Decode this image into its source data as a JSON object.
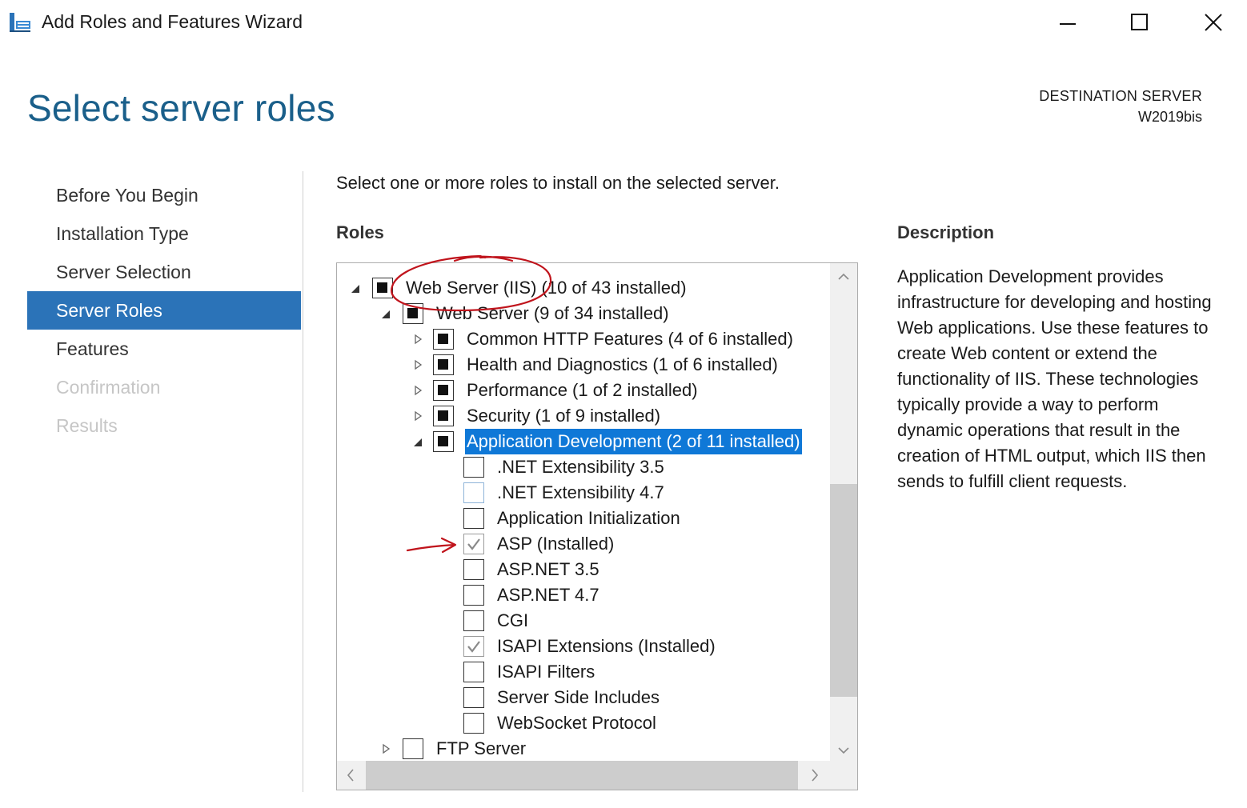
{
  "window": {
    "title": "Add Roles and Features Wizard",
    "icon": "server-manager-icon",
    "controls": [
      "minimize-icon",
      "maximize-icon",
      "close-icon"
    ]
  },
  "header": {
    "page_title": "Select server roles",
    "destination_label": "DESTINATION SERVER",
    "destination_name": "W2019bis"
  },
  "nav": {
    "items": [
      {
        "label": "Before You Begin",
        "state": "enabled"
      },
      {
        "label": "Installation Type",
        "state": "enabled"
      },
      {
        "label": "Server Selection",
        "state": "enabled"
      },
      {
        "label": "Server Roles",
        "state": "active"
      },
      {
        "label": "Features",
        "state": "enabled"
      },
      {
        "label": "Confirmation",
        "state": "disabled"
      },
      {
        "label": "Results",
        "state": "disabled"
      }
    ]
  },
  "main": {
    "instructions": "Select one or more roles to install on the selected server.",
    "roles_heading": "Roles",
    "description_heading": "Description",
    "description_text": "Application Development provides infrastructure for developing and hosting Web applications. Use these features to create Web content or extend the functionality of IIS. These technologies typically provide a way to perform dynamic operations that result in the creation of HTML output, which IIS then sends to fulfill client requests."
  },
  "roles_tree": [
    {
      "label": "Web Server (IIS) (10 of 43 installed)",
      "level": 0,
      "expander": "expanded",
      "check": "partial"
    },
    {
      "label": "Web Server (9 of 34 installed)",
      "level": 1,
      "expander": "expanded",
      "check": "partial"
    },
    {
      "label": "Common HTTP Features (4 of 6 installed)",
      "level": 2,
      "expander": "collapsed",
      "check": "partial"
    },
    {
      "label": "Health and Diagnostics (1 of 6 installed)",
      "level": 2,
      "expander": "collapsed",
      "check": "partial"
    },
    {
      "label": "Performance (1 of 2 installed)",
      "level": 2,
      "expander": "collapsed",
      "check": "partial"
    },
    {
      "label": "Security (1 of 9 installed)",
      "level": 2,
      "expander": "collapsed",
      "check": "partial"
    },
    {
      "label": "Application Development (2 of 11 installed)",
      "level": 2,
      "expander": "expanded",
      "check": "partial",
      "selected": true
    },
    {
      "label": ".NET Extensibility 3.5",
      "level": 3,
      "expander": "none",
      "check": "unchecked"
    },
    {
      "label": ".NET Extensibility 4.7",
      "level": 3,
      "expander": "none",
      "check": "unchecked",
      "hover": true
    },
    {
      "label": "Application Initialization",
      "level": 3,
      "expander": "none",
      "check": "unchecked"
    },
    {
      "label": "ASP (Installed)",
      "level": 3,
      "expander": "none",
      "check": "checked"
    },
    {
      "label": "ASP.NET 3.5",
      "level": 3,
      "expander": "none",
      "check": "unchecked"
    },
    {
      "label": "ASP.NET 4.7",
      "level": 3,
      "expander": "none",
      "check": "unchecked"
    },
    {
      "label": "CGI",
      "level": 3,
      "expander": "none",
      "check": "unchecked"
    },
    {
      "label": "ISAPI Extensions (Installed)",
      "level": 3,
      "expander": "none",
      "check": "checked"
    },
    {
      "label": "ISAPI Filters",
      "level": 3,
      "expander": "none",
      "check": "unchecked"
    },
    {
      "label": "Server Side Includes",
      "level": 3,
      "expander": "none",
      "check": "unchecked"
    },
    {
      "label": "WebSocket Protocol",
      "level": 3,
      "expander": "none",
      "check": "unchecked"
    },
    {
      "label": "FTP Server",
      "level": 1,
      "expander": "collapsed",
      "check": "unchecked"
    }
  ],
  "colors": {
    "title_blue": "#1a5f8a",
    "nav_active": "#2b73b8",
    "selection": "#0f78d7",
    "annotation_red": "#c0141c"
  }
}
